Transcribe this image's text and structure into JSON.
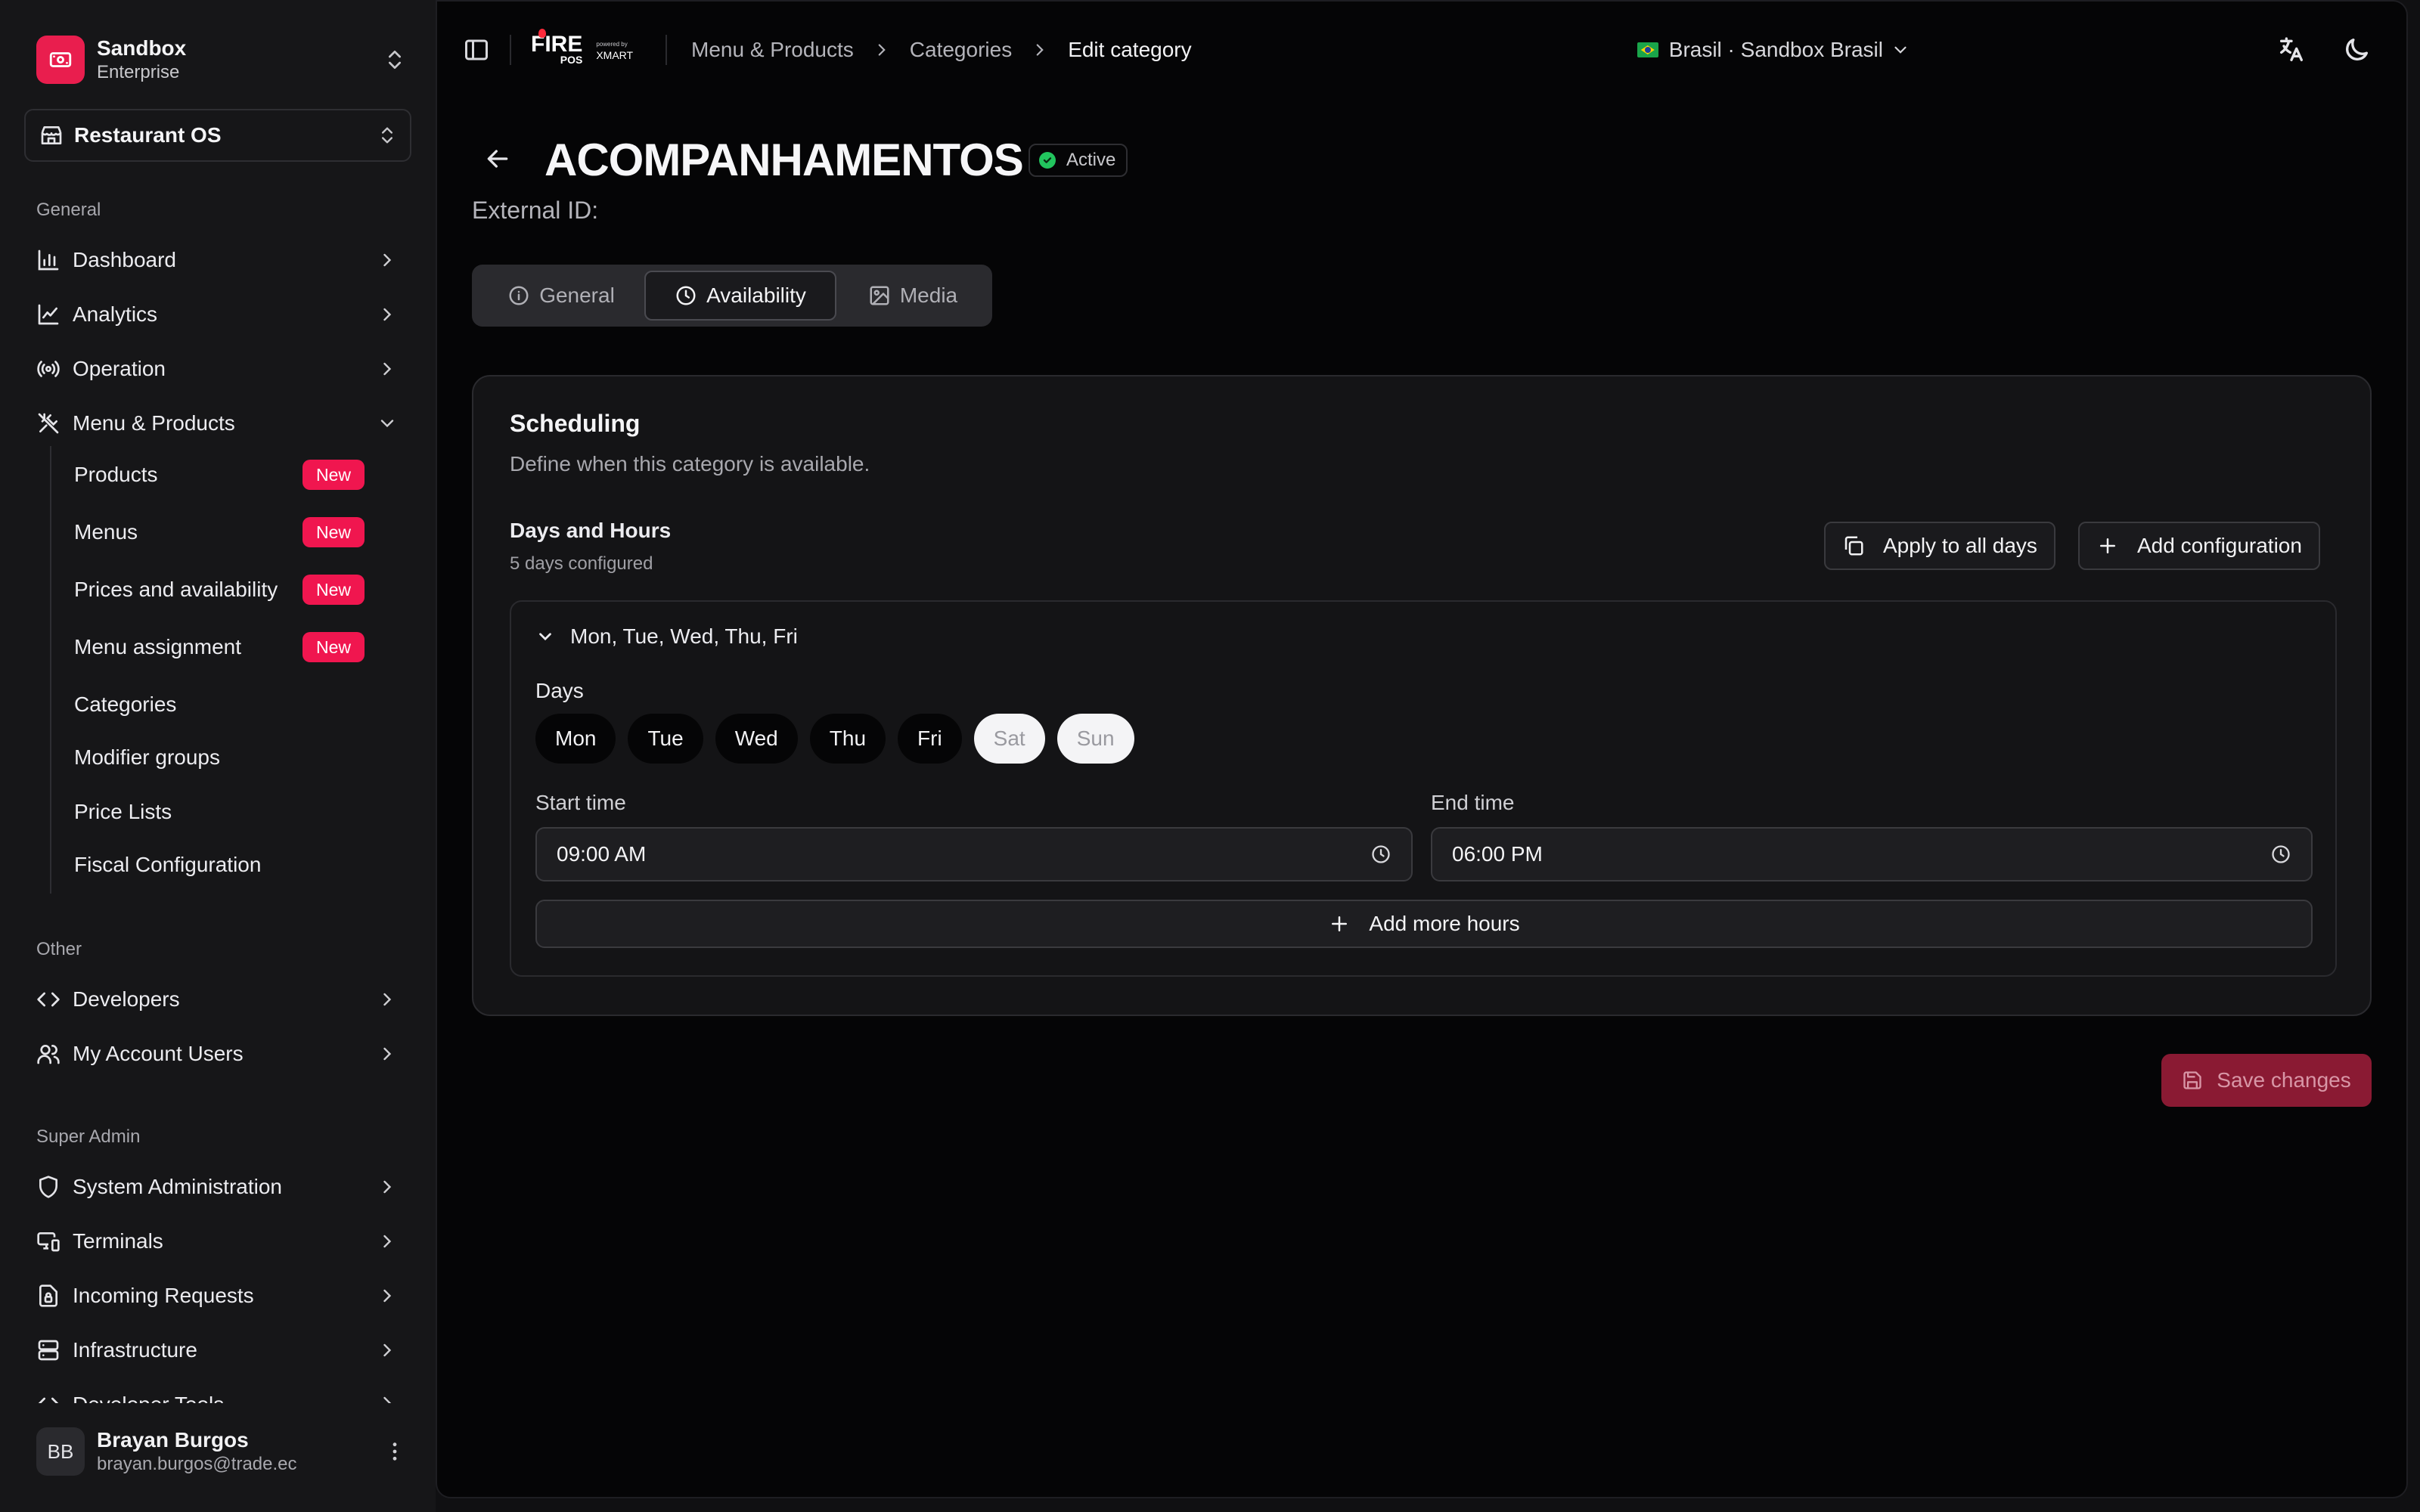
{
  "sidebar": {
    "org": {
      "name": "Sandbox",
      "plan": "Enterprise"
    },
    "app": {
      "label": "Restaurant OS"
    },
    "sections": {
      "general": "General",
      "other": "Other",
      "super_admin": "Super Admin"
    },
    "general_items": [
      "Dashboard",
      "Analytics",
      "Operation",
      "Menu & Products"
    ],
    "menu_sub_items": [
      {
        "label": "Products",
        "badge": "New"
      },
      {
        "label": "Menus",
        "badge": "New"
      },
      {
        "label": "Prices and availability",
        "badge": "New"
      },
      {
        "label": "Menu assignment",
        "badge": "New"
      },
      {
        "label": "Categories"
      },
      {
        "label": "Modifier groups"
      },
      {
        "label": "Price Lists"
      },
      {
        "label": "Fiscal Configuration"
      }
    ],
    "other_items": [
      "Developers",
      "My Account Users"
    ],
    "admin_items": [
      "System Administration",
      "Terminals",
      "Incoming Requests",
      "Infrastructure",
      "Developer Tools"
    ],
    "user": {
      "initials": "BB",
      "name": "Brayan Burgos",
      "email": "brayan.burgos@trade.ec"
    }
  },
  "topbar": {
    "brand": {
      "fire": "FIRE",
      "pos": "POS",
      "powered": "powered by",
      "xmart": "XMART"
    },
    "breadcrumb": [
      "Menu & Products",
      "Categories",
      "Edit category"
    ],
    "store": "Brasil · Sandbox Brasil"
  },
  "page": {
    "title": "ACOMPANHAMENTOS",
    "status": "Active",
    "external_id_label": "External ID:",
    "tabs": [
      "General",
      "Availability",
      "Media"
    ],
    "active_tab": "Availability"
  },
  "scheduling": {
    "title": "Scheduling",
    "description": "Define when this category is available.",
    "days_hours_title": "Days and Hours",
    "days_configured": "5 days configured",
    "apply_all_label": "Apply to all days",
    "add_config_label": "Add configuration",
    "config": {
      "summary": "Mon, Tue, Wed, Thu, Fri",
      "days_label": "Days",
      "days": [
        {
          "label": "Mon",
          "selected": true
        },
        {
          "label": "Tue",
          "selected": true
        },
        {
          "label": "Wed",
          "selected": true
        },
        {
          "label": "Thu",
          "selected": true
        },
        {
          "label": "Fri",
          "selected": true
        },
        {
          "label": "Sat",
          "selected": false
        },
        {
          "label": "Sun",
          "selected": false
        }
      ],
      "start_label": "Start time",
      "start_value": "09:00  AM",
      "end_label": "End time",
      "end_value": "06:00  PM",
      "add_hours_label": "Add more hours"
    },
    "save_label": "Save changes"
  },
  "colors": {
    "accent": "#f0164f",
    "active_status": "#22c55e",
    "save_disabled": "#8a1a33"
  }
}
